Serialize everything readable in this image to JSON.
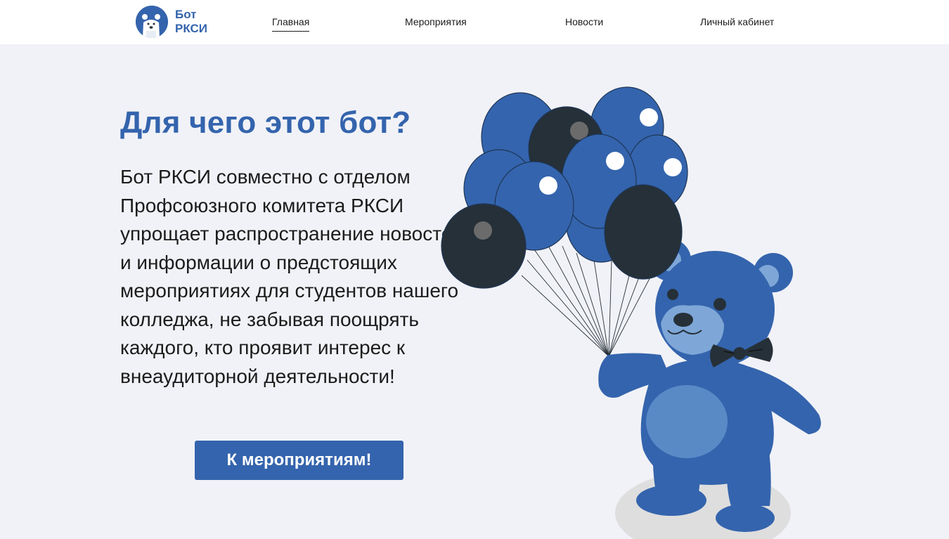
{
  "header": {
    "logo": {
      "line1": "Бот",
      "line2": "РКСИ",
      "icon": "polar-bear-icon"
    },
    "nav": [
      {
        "label": "Главная",
        "active": true
      },
      {
        "label": "Мероприятия",
        "active": false
      },
      {
        "label": "Новости",
        "active": false
      },
      {
        "label": "Личный кабинет",
        "active": false
      }
    ]
  },
  "hero": {
    "title": "Для чего этот бот?",
    "description": "Бот РКСИ совместно с отделом Профсоюзного комитета РКСИ упрощает распространение новостей и информации о предстоящих мероприятиях для студентов нашего колледжа, не забывая поощрять каждого, кто проявит интерес к внеаудиторной деятельности!",
    "cta_label": "К мероприятиям!"
  },
  "illustration": {
    "subject": "teddy-bear-with-balloons"
  },
  "colors": {
    "brand": "#3464ad",
    "background": "#f1f2f7",
    "dark_balloon": "#263038",
    "bear_light": "#5a8ac6"
  }
}
